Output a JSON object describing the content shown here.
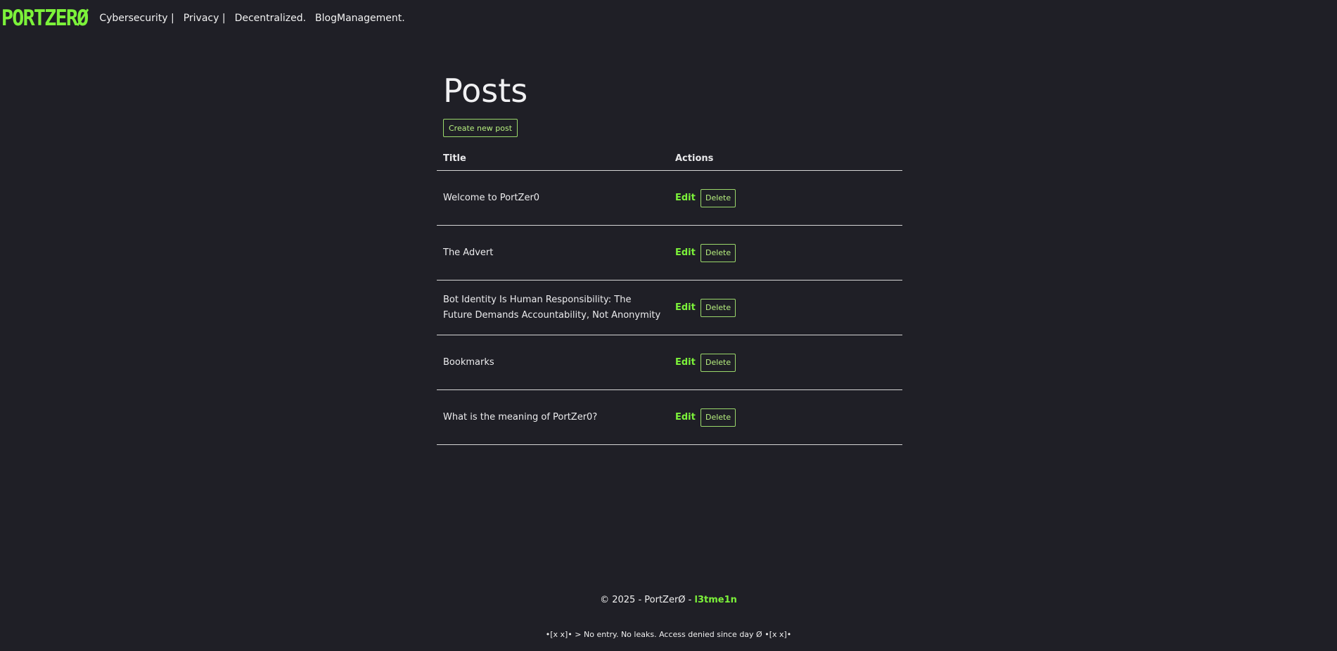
{
  "header": {
    "logo": "PORTZERØ",
    "nav": [
      {
        "label": "Cybersecurity |"
      },
      {
        "label": "Privacy |"
      },
      {
        "label": "Decentralized."
      },
      {
        "label": "BlogManagement."
      }
    ]
  },
  "main": {
    "title": "Posts",
    "create_label": "Create new post",
    "table": {
      "headers": {
        "title": "Title",
        "actions": "Actions"
      },
      "rows": [
        {
          "title": "Welcome to PortZer0",
          "edit": "Edit",
          "delete": "Delete"
        },
        {
          "title": "The Advert",
          "edit": "Edit",
          "delete": "Delete"
        },
        {
          "title": "Bot Identity Is Human Responsibility: The Future Demands Accountability, Not Anonymity",
          "edit": "Edit",
          "delete": "Delete"
        },
        {
          "title": "Bookmarks",
          "edit": "Edit",
          "delete": "Delete"
        },
        {
          "title": "What is the meaning of PortZer0?",
          "edit": "Edit",
          "delete": "Delete"
        }
      ]
    }
  },
  "footer": {
    "copyright": "© 2025 - PortZerØ -",
    "handle": "l3tme1n",
    "motto": "•[x x]• > No entry. No leaks. Access denied since day Ø •[x x]•"
  },
  "colors": {
    "background": "#1f1f26",
    "accent": "#7cf23a",
    "text": "#e8e8ea"
  }
}
